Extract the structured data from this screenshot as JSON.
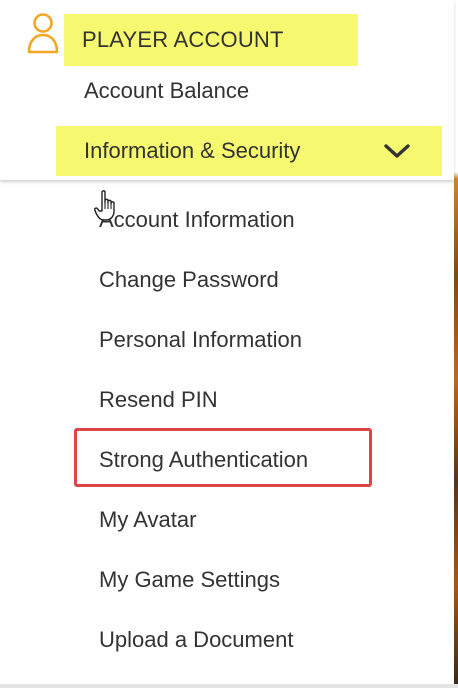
{
  "header": {
    "title": "PLAYER ACCOUNT",
    "icon": "user-icon",
    "highlight_color": "#f6f870",
    "icon_color": "#f5a623"
  },
  "menu": {
    "account_balance": "Account Balance",
    "info_security": {
      "label": "Information & Security",
      "expanded": true,
      "icon": "chevron-down-icon"
    },
    "submenu": [
      {
        "label": "Account Information"
      },
      {
        "label": "Change Password"
      },
      {
        "label": "Personal Information"
      },
      {
        "label": "Resend PIN"
      },
      {
        "label": "Strong Authentication",
        "highlighted": true
      },
      {
        "label": "My Avatar"
      },
      {
        "label": "My Game Settings"
      },
      {
        "label": "Upload a Document"
      }
    ]
  },
  "annotation": {
    "outline_color": "#e04545"
  },
  "cursor": "hand-pointer-icon"
}
